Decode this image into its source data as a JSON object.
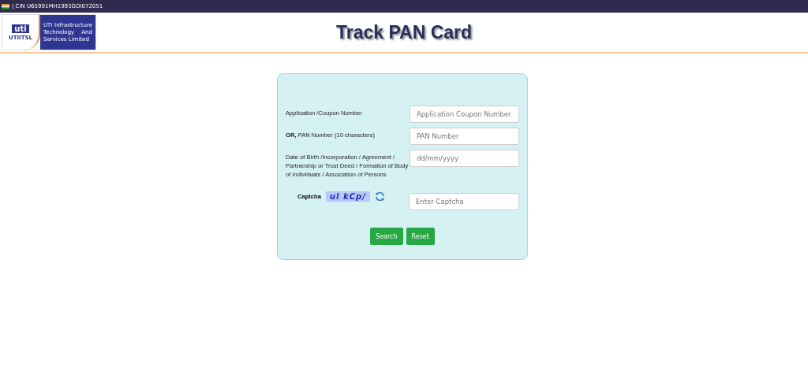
{
  "top_bar": {
    "cin": "| CIN U65991MH1993GOI072051"
  },
  "logo": {
    "mark": "uti",
    "brand": "UTIITSL",
    "company": "UTI Infrastructure Technology And Services Limited"
  },
  "title": "Track PAN Card",
  "form": {
    "fields": [
      {
        "kind": "text",
        "label": "Application /Coupon Number",
        "placeholder": "Application Coupon Number"
      },
      {
        "kind": "text",
        "label": "**OR,** PAN Number (10 characters)",
        "placeholder": "PAN Number"
      },
      {
        "kind": "text",
        "label": "Date of Birth /Incorporation / Agreement / Partnership or Trust Deed / Formation of Body of Individuals / Association of Persons",
        "placeholder": "dd/mm/yyyy"
      },
      {
        "kind": "captcha",
        "label": "Captcha",
        "captcha": "ul kCp/",
        "placeholder": "Enter Captcha"
      }
    ],
    "buttons": [
      "Search",
      "Reset"
    ]
  }
}
